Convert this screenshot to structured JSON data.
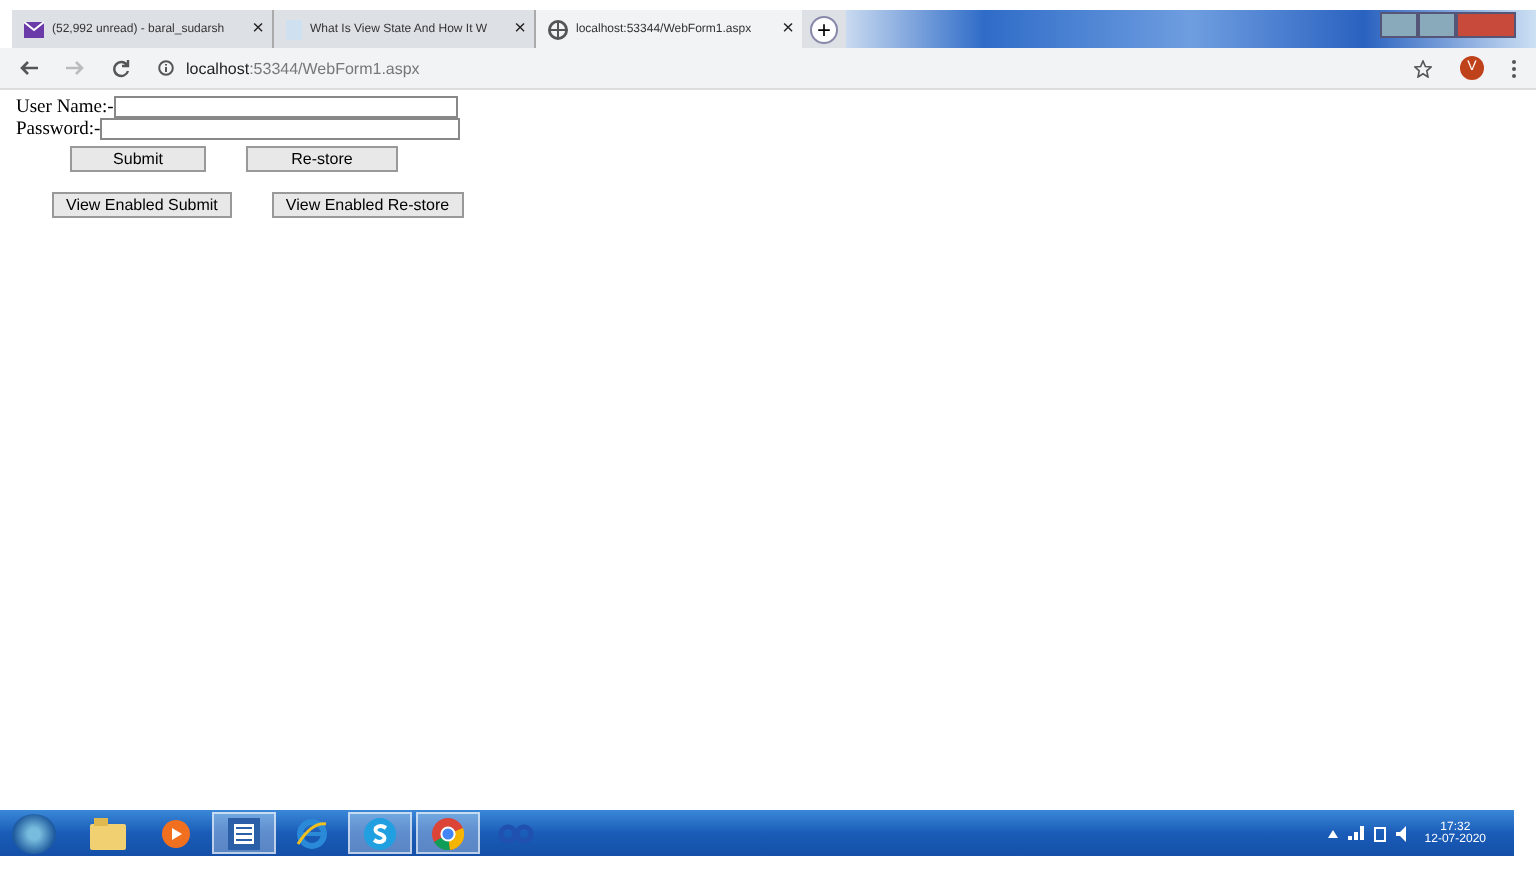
{
  "tabs": [
    {
      "title": "(52,992 unread) - baral_sudarsh",
      "selected": false,
      "close": "×",
      "kind": "mail"
    },
    {
      "title": "What Is View State And How It W",
      "selected": false,
      "close": "×",
      "kind": "doc"
    },
    {
      "title": "localhost:53344/WebForm1.aspx",
      "selected": true,
      "close": "×",
      "kind": "globe"
    }
  ],
  "new_tab": "+",
  "address_bar": {
    "host": "localhost",
    "rest": ":53344/WebForm1.aspx",
    "profile": "V"
  },
  "form": {
    "fields": [
      {
        "label": "User Name:-"
      },
      {
        "label": "Password:-"
      }
    ],
    "button_rows": [
      [
        "Submit",
        "Re-store"
      ],
      [
        "View Enabled Submit",
        "View Enabled Re-store"
      ]
    ]
  },
  "taskbar": {
    "apps": [
      {
        "kind": "folder",
        "selected": false
      },
      {
        "kind": "media",
        "selected": false
      },
      {
        "kind": "word",
        "selected": true
      },
      {
        "kind": "ie",
        "selected": false
      },
      {
        "kind": "skype",
        "selected": true
      },
      {
        "kind": "chrome",
        "selected": true
      },
      {
        "kind": "app",
        "selected": false
      }
    ],
    "time": "17:32",
    "date": "12-07-2020"
  }
}
